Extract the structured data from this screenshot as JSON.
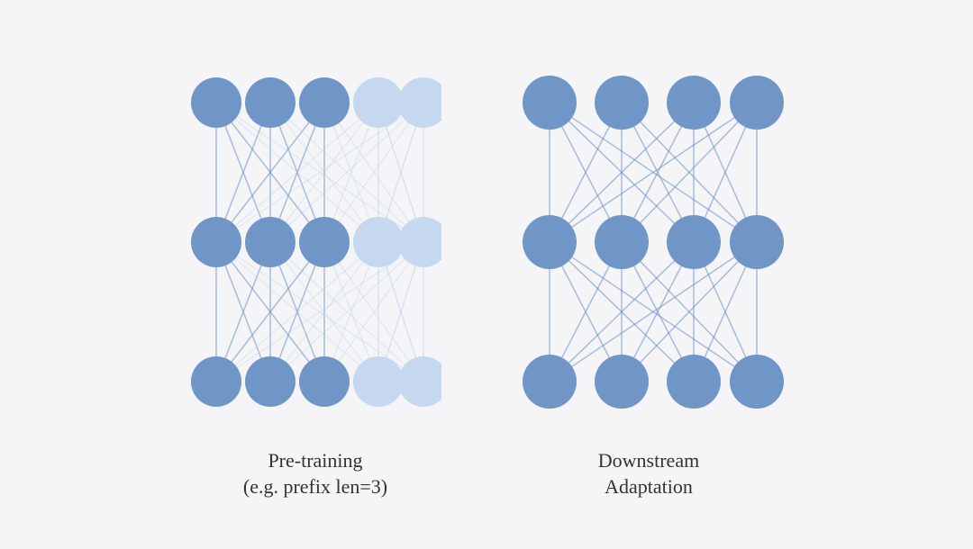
{
  "left_diagram": {
    "caption_line1": "Pre-training",
    "caption_line2": "(e.g. prefix len=3)",
    "dark_color": "#7096C8",
    "light_color": "#C5D8EF",
    "stroke_dark": "rgba(100,140,200,0.55)",
    "stroke_light": "rgba(180,205,230,0.45)"
  },
  "right_diagram": {
    "caption_line1": "Downstream",
    "caption_line2": "Adaptation",
    "node_color": "#7096C8",
    "stroke_color": "rgba(100,140,200,0.55)"
  }
}
